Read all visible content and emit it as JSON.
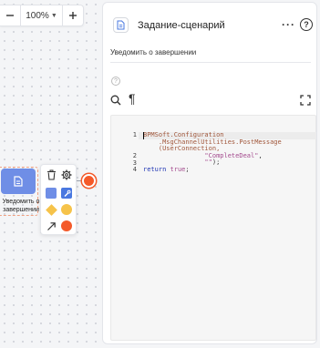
{
  "zoom": {
    "value": "100%",
    "minus_icon": "minus-icon",
    "plus_icon": "plus-icon"
  },
  "canvas": {
    "node_label": "Уведомить о завершении",
    "node_icon": "document-icon",
    "node_color": "#6f8ee6",
    "end_event_color": "#f45a2a",
    "palette": [
      {
        "name": "trash-icon"
      },
      {
        "name": "gear-icon"
      },
      {
        "name": "task-shape",
        "color": "#6f8ee6"
      },
      {
        "name": "script-task-shape",
        "color": "#4a78e0"
      },
      {
        "name": "gateway-shape",
        "color": "#f6c34a"
      },
      {
        "name": "intermediate-event-shape",
        "color": "#f6c34a"
      },
      {
        "name": "connector-arrow-icon"
      },
      {
        "name": "end-event-shape",
        "color": "#f45a2a"
      }
    ]
  },
  "panel": {
    "title": "Задание-сценарий",
    "subtitle": "Уведомить о завершении",
    "more_label": "···",
    "help_label": "?",
    "hint_label": "?",
    "pilcrow": "¶"
  },
  "editor": {
    "line_numbers": [
      "1",
      "2",
      "3",
      "4"
    ],
    "lines": [
      {
        "parts": [
          {
            "t": "BPMSoft.Configuration",
            "c": "t-class"
          }
        ]
      },
      {
        "parts": [
          {
            "t": "    .MsgChannelUtilities.PostMessage",
            "c": "t-class"
          }
        ]
      },
      {
        "parts": [
          {
            "t": "    (UserConnection,",
            "c": "t-class"
          }
        ]
      },
      {
        "parts": [
          {
            "t": "                \"CompleteDeal\"",
            "c": "t-str"
          },
          {
            "t": ",",
            "c": "t-plain"
          }
        ]
      },
      {
        "parts": [
          {
            "t": "                \"\"",
            "c": "t-str"
          },
          {
            "t": ");",
            "c": "t-plain"
          }
        ]
      },
      {
        "parts": [
          {
            "t": "return ",
            "c": "t-kw"
          },
          {
            "t": "true",
            "c": "t-num"
          },
          {
            "t": ";",
            "c": "t-plain"
          }
        ]
      }
    ]
  }
}
